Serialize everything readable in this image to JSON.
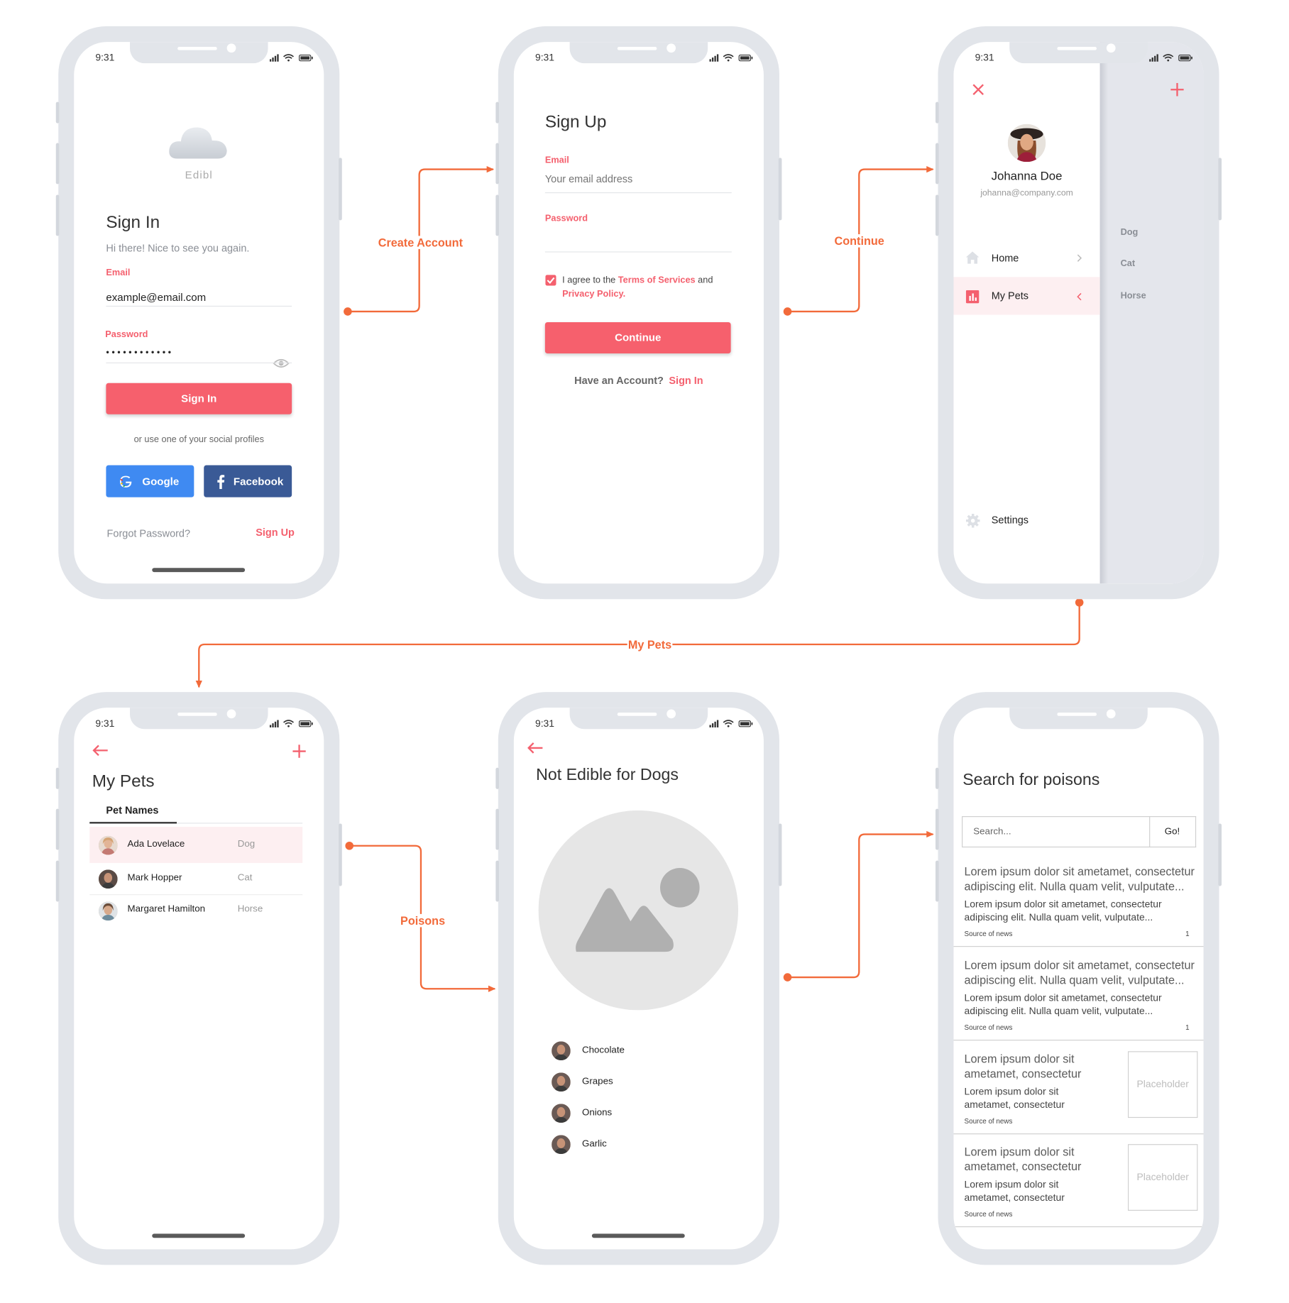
{
  "status_bar": {
    "time": "9:31"
  },
  "connectors": {
    "create_account": "Create Account",
    "continue": "Continue",
    "my_pets": "My Pets",
    "poisons": "Poisons",
    "color": "#f26a3a"
  },
  "signin": {
    "logo_text": "Edibl",
    "title": "Sign In",
    "subtitle": "Hi there! Nice to see you again.",
    "email_label": "Email",
    "email_value": "example@email.com",
    "password_label": "Password",
    "password_value": "••••••••••••",
    "signin_button": "Sign In",
    "social_text": "or use one of your social profiles",
    "google_button": "Google",
    "facebook_button": "Facebook",
    "forgot_link": "Forgot Password?",
    "signup_link": "Sign Up"
  },
  "signup": {
    "title": "Sign Up",
    "email_label": "Email",
    "email_placeholder": "Your email address",
    "password_label": "Password",
    "agree_prefix": "I agree to the ",
    "terms_link": "Terms of Services",
    "agree_and": " and",
    "privacy_link": "Privacy Policy.",
    "continue_button": "Continue",
    "have_account": "Have an Account?",
    "signin_link": "Sign In"
  },
  "menu": {
    "user_name": "Johanna Doe",
    "user_email": "johanna@company.com",
    "items": [
      {
        "label": "Home",
        "icon": "home-icon",
        "active": false
      },
      {
        "label": "My Pets",
        "icon": "chart-icon",
        "active": true
      }
    ],
    "settings_label": "Settings",
    "behind_list": [
      "Dog",
      "Cat",
      "Horse"
    ]
  },
  "mypets": {
    "title": "My Pets",
    "tab_label": "Pet Names",
    "rows": [
      {
        "name": "Ada Lovelace",
        "type": "Dog",
        "highlighted": true
      },
      {
        "name": "Mark Hopper",
        "type": "Cat",
        "highlighted": false
      },
      {
        "name": "Margaret Hamilton",
        "type": "Horse",
        "highlighted": false
      }
    ]
  },
  "notedible": {
    "title": "Not Edible for Dogs",
    "items": [
      "Chocolate",
      "Grapes",
      "Onions",
      "Garlic"
    ]
  },
  "search": {
    "title": "Search for poisons",
    "input_placeholder": "Search...",
    "go_button": "Go!",
    "results": [
      {
        "title": "Lorem ipsum dolor sit ametamet, consectetur adipiscing elit. Nulla quam velit, vulputate...",
        "body": "Lorem ipsum dolor sit ametamet, consectetur adipiscing elit. Nulla quam velit, vulputate...",
        "source": "Source of news",
        "count": "1"
      },
      {
        "title": "Lorem ipsum dolor sit ametamet, consectetur adipiscing elit. Nulla quam velit, vulputate...",
        "body": "Lorem ipsum dolor sit ametamet, consectetur adipiscing elit. Nulla quam velit, vulputate...",
        "source": "Source of news",
        "count": "1"
      },
      {
        "title": "Lorem ipsum dolor sit ametamet, consectetur",
        "body": "Lorem ipsum dolor sit ametamet, consectetur",
        "source": "Source of news",
        "image": "Placeholder"
      },
      {
        "title": "Lorem ipsum dolor sit ametamet, consectetur",
        "body": "Lorem ipsum dolor sit ametamet, consectetur",
        "source": "Source of news",
        "image": "Placeholder"
      }
    ]
  }
}
